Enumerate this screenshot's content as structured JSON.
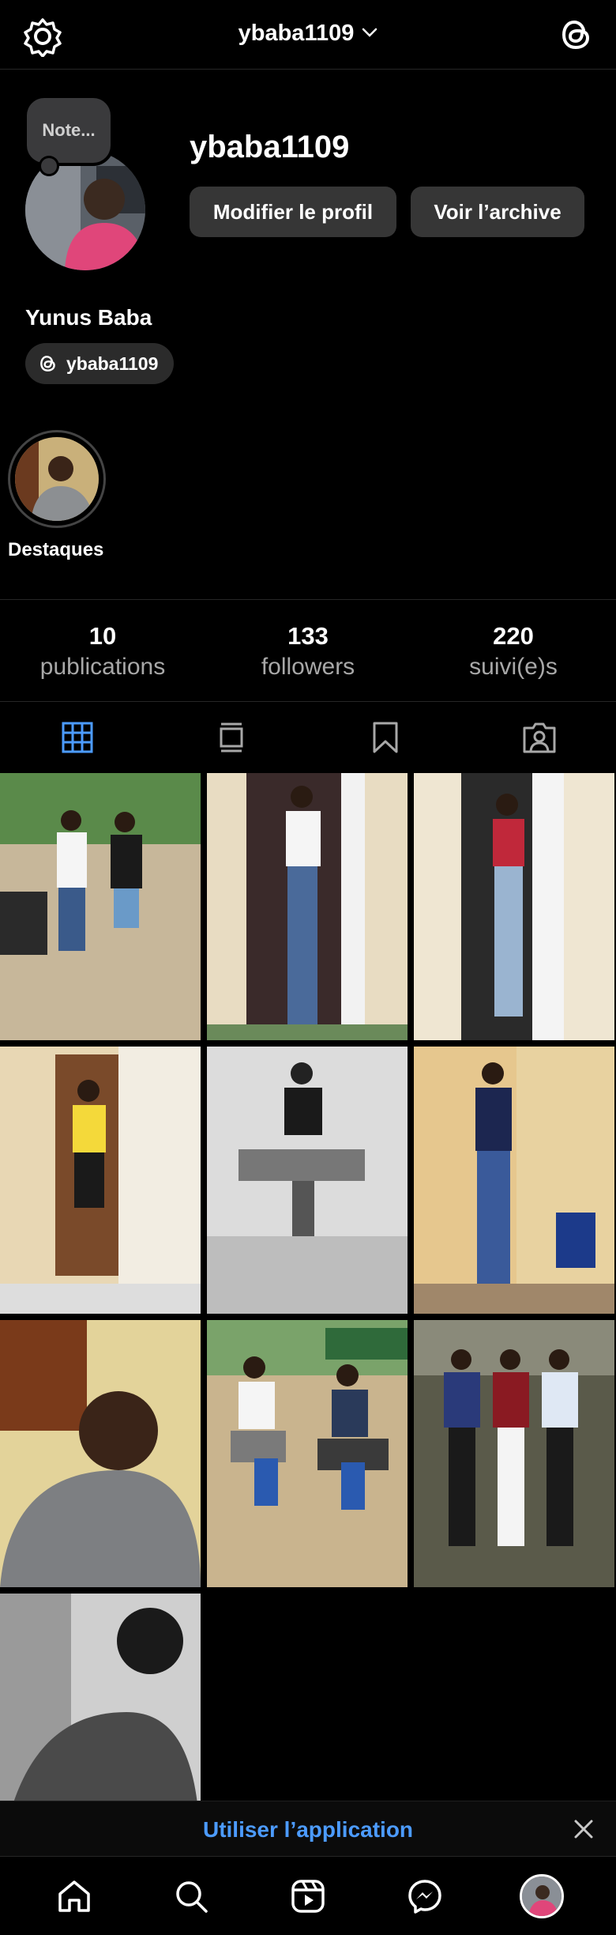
{
  "header": {
    "username": "ybaba1109",
    "icons": {
      "left": "settings-gear-icon",
      "right": "threads-icon",
      "switch": "chevron-down-icon"
    }
  },
  "profile": {
    "note_placeholder": "Note...",
    "username": "ybaba1109",
    "edit_button": "Modifier le profil",
    "archive_button": "Voir l’archive",
    "full_name": "Yunus Baba",
    "threads_handle": "ybaba1109"
  },
  "highlights": [
    {
      "label": "Destaques"
    }
  ],
  "stats": [
    {
      "value": "10",
      "label": "publications"
    },
    {
      "value": "133",
      "label": "followers"
    },
    {
      "value": "220",
      "label": "suivi(e)s"
    }
  ],
  "tabs": [
    {
      "name": "grid",
      "icon": "grid-icon",
      "active": true
    },
    {
      "name": "feed",
      "icon": "feed-icon",
      "active": false
    },
    {
      "name": "saved",
      "icon": "bookmark-icon",
      "active": false
    },
    {
      "name": "tagged",
      "icon": "tagged-person-icon",
      "active": false
    }
  ],
  "posts_count": 10,
  "banner": {
    "text": "Utiliser l’application"
  },
  "bottom_nav": [
    {
      "name": "home",
      "icon": "home-icon"
    },
    {
      "name": "search",
      "icon": "search-icon"
    },
    {
      "name": "reels",
      "icon": "reels-icon"
    },
    {
      "name": "messenger",
      "icon": "messenger-icon"
    },
    {
      "name": "profile",
      "icon": "avatar"
    }
  ],
  "colors": {
    "accent": "#4c9bff",
    "background": "#000000",
    "button": "#363636",
    "muted_text": "#a8a8a8"
  }
}
